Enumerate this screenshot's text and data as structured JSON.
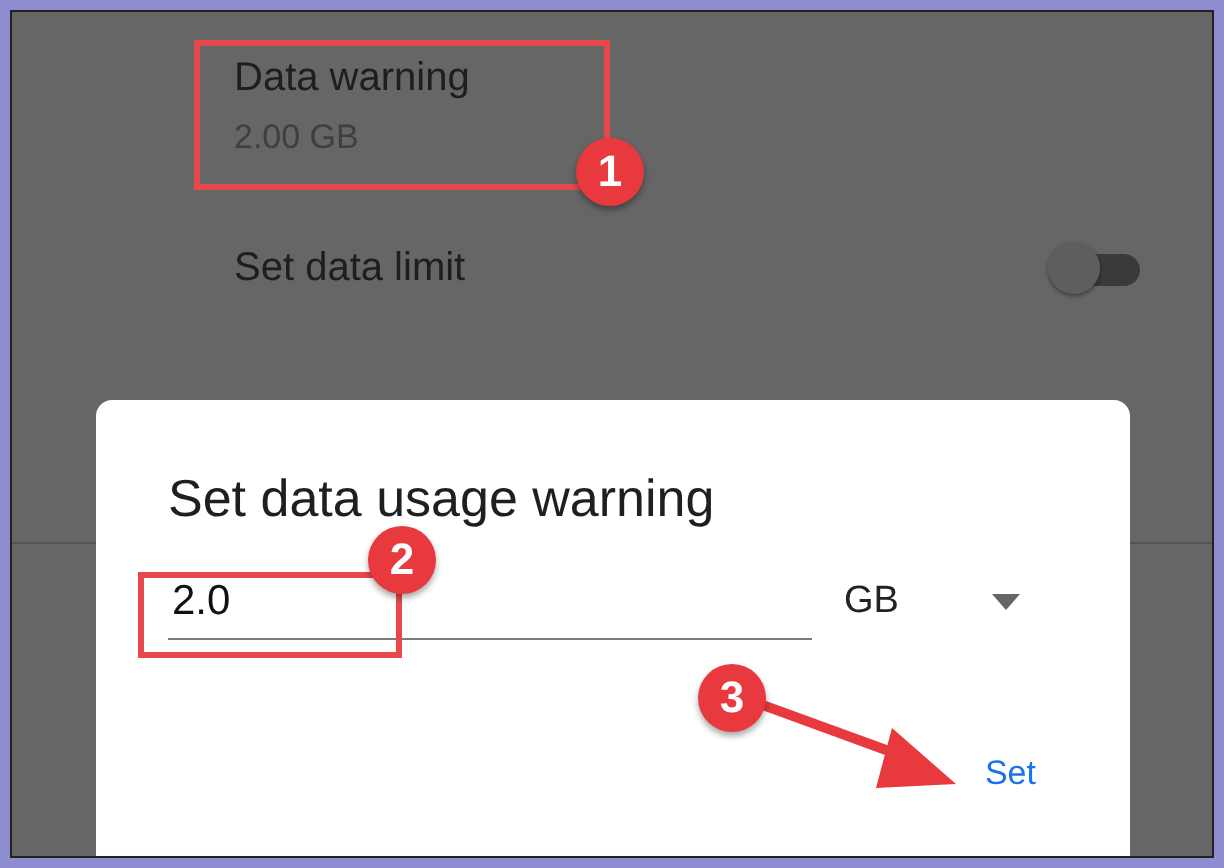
{
  "settings": [
    {
      "kind": "value",
      "title": "Data warning",
      "value": "2.00 GB"
    },
    {
      "kind": "switch",
      "title": "Set data limit",
      "on": false
    }
  ],
  "dialog": {
    "title": "Set data usage warning",
    "value": "2.0",
    "unit": "GB",
    "button": "Set"
  },
  "annotations": [
    {
      "number": "1"
    },
    {
      "number": "2"
    },
    {
      "number": "3"
    }
  ]
}
